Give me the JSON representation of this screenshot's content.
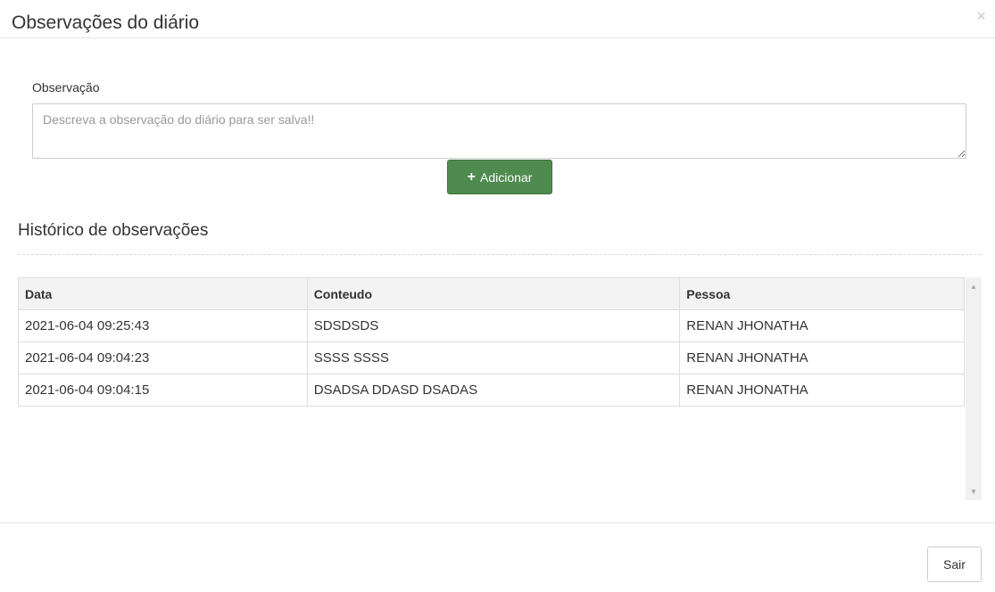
{
  "modal": {
    "title": "Observações do diário",
    "close_glyph": "×"
  },
  "form": {
    "label": "Observação",
    "placeholder": "Descreva a observação do diário para ser salva!!",
    "value": "",
    "add_icon": "plus-icon",
    "add_label": "Adicionar"
  },
  "history": {
    "title": "Histórico de observações",
    "columns": [
      "Data",
      "Conteudo",
      "Pessoa"
    ],
    "rows": [
      [
        "2021-06-04 09:25:43",
        "SDSDSDS",
        "RENAN JHONATHA"
      ],
      [
        "2021-06-04 09:04:23",
        "SSSS SSSS",
        "RENAN JHONATHA"
      ],
      [
        "2021-06-04 09:04:15",
        "DSADSA DDASD DSADAS",
        "RENAN JHONATHA"
      ]
    ]
  },
  "footer": {
    "exit_label": "Sair"
  },
  "colors": {
    "add_button": "#4f8a4f",
    "header_bg": "#f3f3f3",
    "border": "#dddddd"
  }
}
